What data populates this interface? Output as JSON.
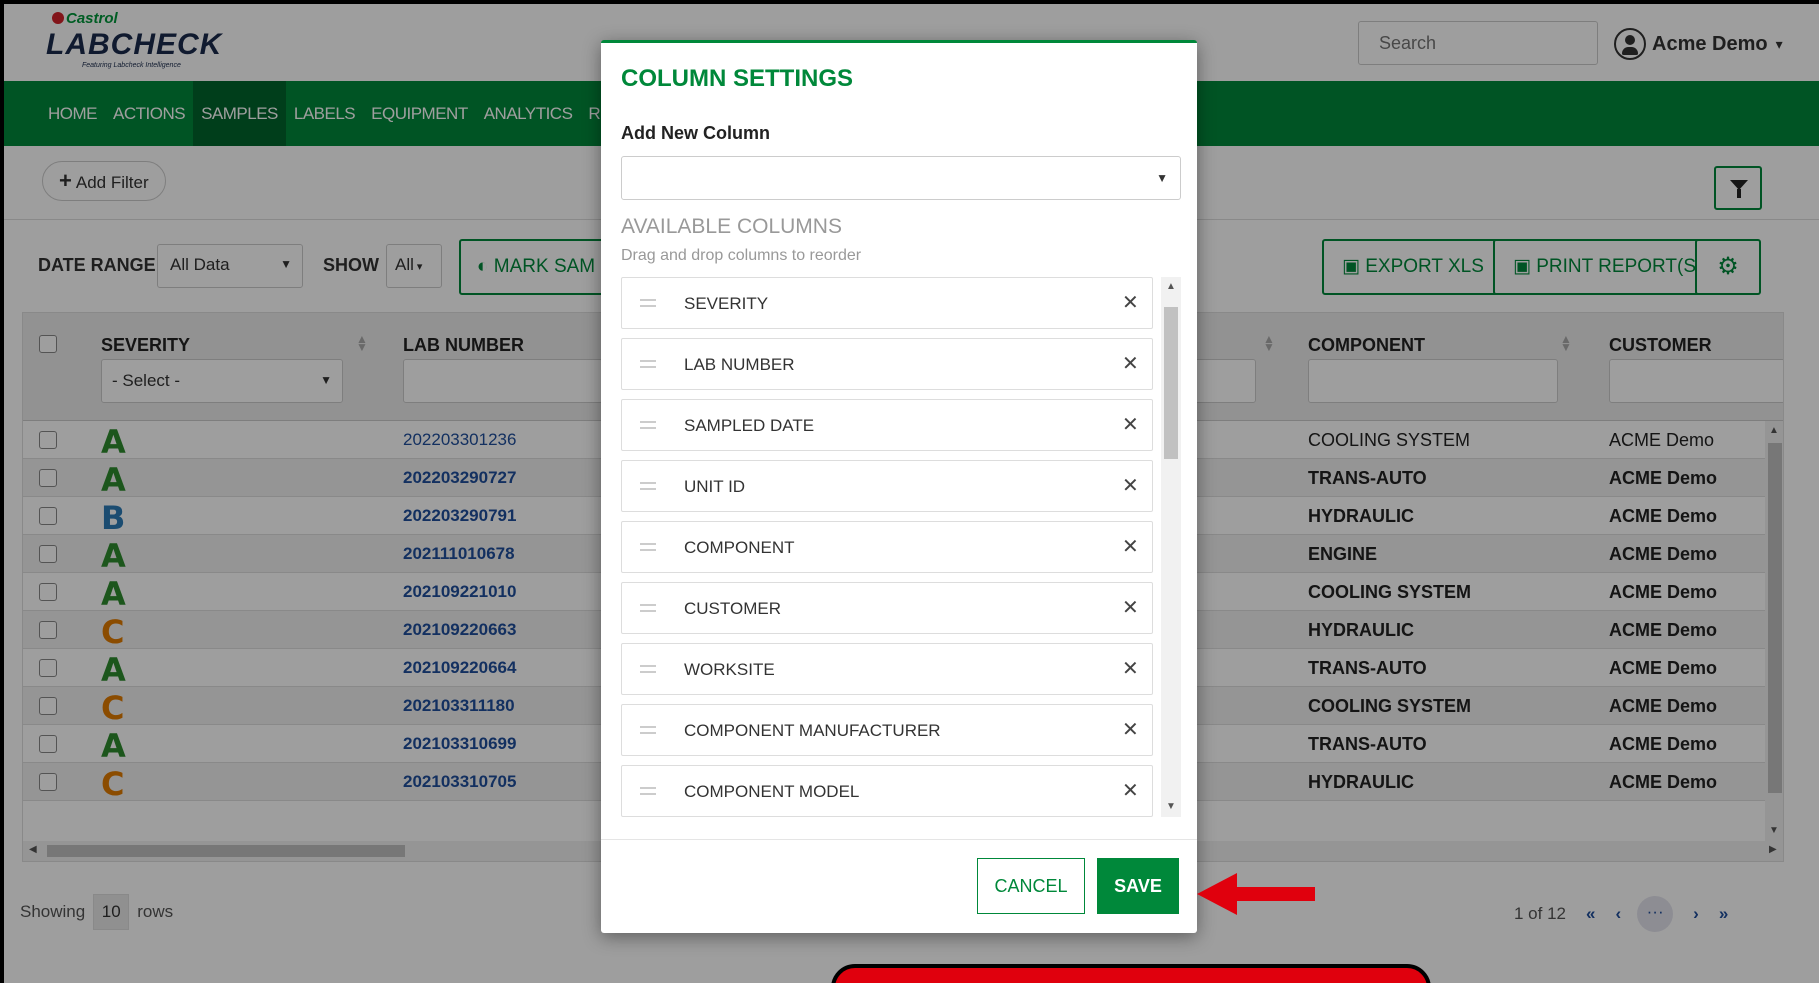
{
  "header": {
    "brand": "Castrol",
    "product": "LABCHECK",
    "tagline": "Featuring Labcheck Intelligence",
    "search_placeholder": "Search",
    "user_name": "Acme Demo"
  },
  "nav": {
    "items": [
      "HOME",
      "ACTIONS",
      "SAMPLES",
      "LABELS",
      "EQUIPMENT",
      "ANALYTICS",
      "R"
    ],
    "active": "SAMPLES"
  },
  "filters": {
    "add_filter": "Add Filter"
  },
  "controls": {
    "date_range_label": "DATE RANGE",
    "date_range_value": "All Data",
    "show_label": "SHOW",
    "show_value": "All",
    "mark_button": "MARK SAM",
    "export_button": "EXPORT XLS",
    "print_button": "PRINT REPORT(S)"
  },
  "table": {
    "columns": {
      "severity": "SEVERITY",
      "lab_number": "LAB NUMBER",
      "component": "COMPONENT",
      "customer": "CUSTOMER"
    },
    "severity_filter": "- Select -",
    "rows": [
      {
        "grade": "A",
        "lab": "202203301236",
        "component": "COOLING SYSTEM",
        "customer": "ACME Demo"
      },
      {
        "grade": "A",
        "lab": "202203290727",
        "component": "TRANS-AUTO",
        "customer": "ACME Demo"
      },
      {
        "grade": "B",
        "lab": "202203290791",
        "component": "HYDRAULIC",
        "customer": "ACME Demo"
      },
      {
        "grade": "A",
        "lab": "202111010678",
        "component": "ENGINE",
        "customer": "ACME Demo"
      },
      {
        "grade": "A",
        "lab": "202109221010",
        "component": "COOLING SYSTEM",
        "customer": "ACME Demo"
      },
      {
        "grade": "C",
        "lab": "202109220663",
        "component": "HYDRAULIC",
        "customer": "ACME Demo"
      },
      {
        "grade": "A",
        "lab": "202109220664",
        "component": "TRANS-AUTO",
        "customer": "ACME Demo"
      },
      {
        "grade": "C",
        "lab": "202103311180",
        "component": "COOLING SYSTEM",
        "customer": "ACME Demo"
      },
      {
        "grade": "A",
        "lab": "202103310699",
        "component": "TRANS-AUTO",
        "customer": "ACME Demo"
      },
      {
        "grade": "C",
        "lab": "202103310705",
        "component": "HYDRAULIC",
        "customer": "ACME Demo"
      }
    ]
  },
  "pager": {
    "showing": "Showing",
    "rows_count": "10",
    "rows": "rows",
    "page_info": "1 of 12",
    "first": "«",
    "prev": "‹",
    "current": "···",
    "next": "›",
    "last": "»"
  },
  "modal": {
    "title": "COLUMN SETTINGS",
    "add_label": "Add New Column",
    "available_title": "AVAILABLE COLUMNS",
    "available_hint": "Drag and drop columns to reorder",
    "columns": [
      "SEVERITY",
      "LAB NUMBER",
      "SAMPLED DATE",
      "UNIT ID",
      "COMPONENT",
      "CUSTOMER",
      "WORKSITE",
      "COMPONENT MANUFACTURER",
      "COMPONENT MODEL"
    ],
    "cancel": "CANCEL",
    "save": "SAVE"
  },
  "colors": {
    "brand_green": "#00883a",
    "nav_active": "#00652c",
    "grade_A": "#2e8b2e",
    "grade_B": "#2c7bb6",
    "grade_C": "#e07b00",
    "annotation_red": "#e0000d"
  }
}
